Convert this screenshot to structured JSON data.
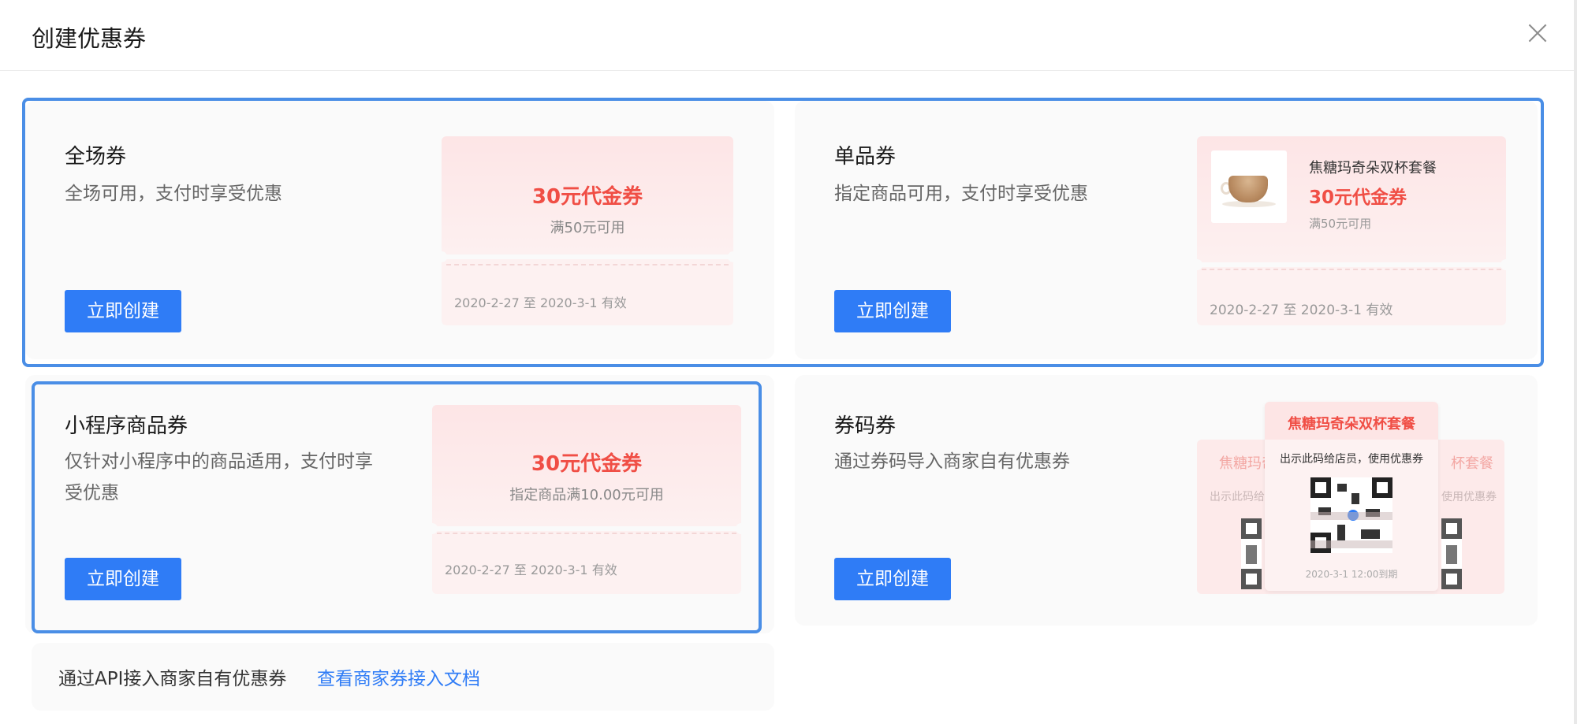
{
  "dialog": {
    "title": "创建优惠券"
  },
  "cards": [
    {
      "title": "全场券",
      "desc": "全场可用，支付时享受优惠",
      "button": "立即创建",
      "ticket": {
        "amount": "30元代金券",
        "condition": "满50元可用",
        "validity": "2020-2-27 至 2020-3-1 有效"
      }
    },
    {
      "title": "单品券",
      "desc": "指定商品可用，支付时享受优惠",
      "button": "立即创建",
      "ticket": {
        "product": "焦糖玛奇朵双杯套餐",
        "amount": "30元代金券",
        "condition": "满50元可用",
        "validity": "2020-2-27 至 2020-3-1 有效"
      }
    },
    {
      "title": "小程序商品券",
      "desc_line1": "仅针对小程序中的商品适用，支付时享",
      "desc_line2": "受优惠",
      "button": "立即创建",
      "ticket": {
        "amount": "30元代金券",
        "condition": "指定商品满10.00元可用",
        "validity": "2020-2-27 至 2020-3-1 有效"
      }
    },
    {
      "title": "券码券",
      "desc": "通过券码导入商家自有优惠券",
      "button": "立即创建",
      "ticket": {
        "product": "焦糖玛奇朵双杯套餐",
        "instruction": "出示此码给店员，使用优惠券",
        "back_left_title": "焦糖玛奇",
        "back_right_title": "杯套餐",
        "back_left_instruction": "出示此码给",
        "back_right_instruction": "使用优惠券",
        "expiry": "2020-3-1 12:00到期"
      }
    }
  ],
  "api": {
    "text": "通过API接入商家自有优惠券",
    "link": "查看商家券接入文档"
  },
  "colors": {
    "primary": "#2f7cf6",
    "highlight": "#4a8ee6",
    "coupon_red": "#f04e45",
    "coupon_bg": "#fde5e6"
  }
}
